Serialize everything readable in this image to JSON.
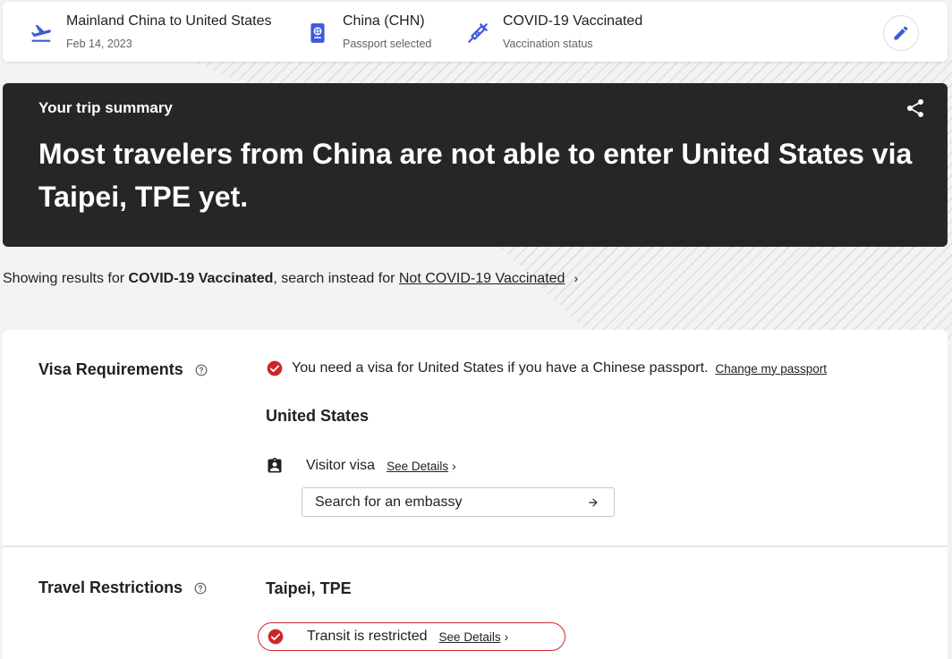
{
  "topbar": {
    "route": {
      "title": "Mainland China to United States",
      "subtitle": "Feb 14, 2023",
      "icon": "flight-takeoff-icon"
    },
    "passport": {
      "title": "China (CHN)",
      "subtitle": "Passport selected",
      "icon": "passport-icon"
    },
    "vaccination": {
      "title": "COVID-19 Vaccinated",
      "subtitle": "Vaccination status",
      "icon": "vaccine-syringe-icon"
    },
    "edit_icon": "pencil-icon"
  },
  "summary": {
    "label": "Your trip summary",
    "headline": "Most travelers from China are not able to enter United States via Taipei, TPE yet.",
    "share_icon": "share-icon"
  },
  "results": {
    "prefix": "Showing results for ",
    "current": "COVID-19 Vaccinated",
    "middle": ", search instead for ",
    "alternative": "Not COVID-19 Vaccinated"
  },
  "visa": {
    "title": "Visa Requirements",
    "alert": "You need a visa for United States if you have a Chinese passport.",
    "change_link": "Change my passport",
    "country": "United States",
    "visa_type": "Visitor visa",
    "details_link": "See Details",
    "embassy_placeholder": "Search for an embassy"
  },
  "travel": {
    "title": "Travel Restrictions",
    "airport": "Taipei, TPE",
    "status": "Transit is restricted",
    "details_link": "See Details"
  },
  "colors": {
    "accent_blue": "#3b5bdb",
    "alert_red": "#d0242b",
    "dark_panel": "#262626"
  }
}
